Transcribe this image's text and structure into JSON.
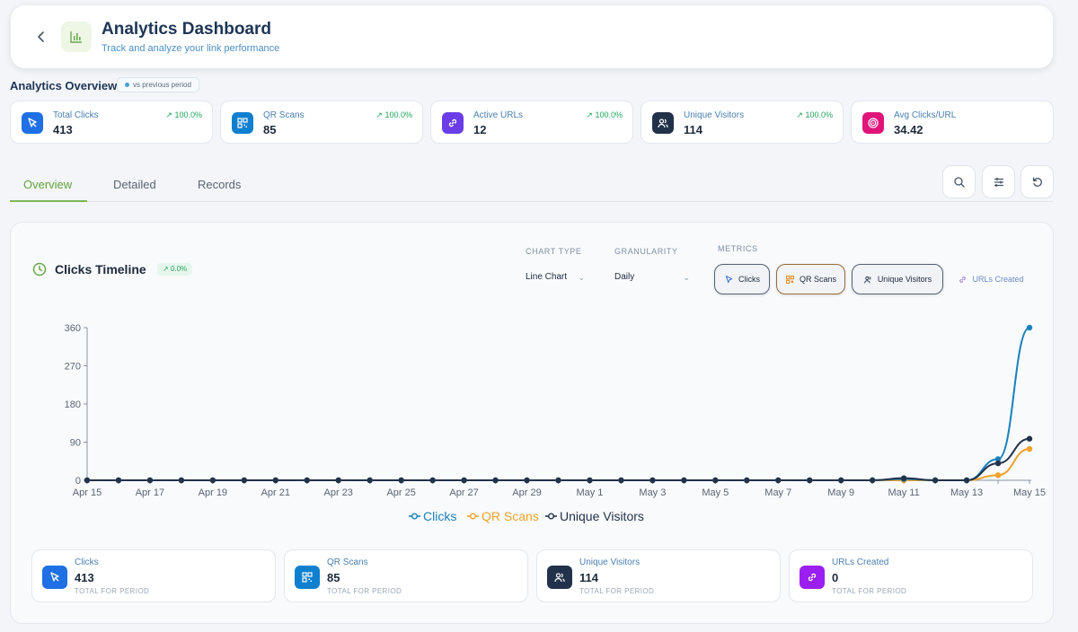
{
  "header": {
    "title": "Analytics Dashboard",
    "subtitle": "Track and analyze your link performance"
  },
  "overview": {
    "title": "Analytics Overview",
    "badge": "vs previous period",
    "cards": [
      {
        "label": "Total Clicks",
        "value": "413",
        "change": "100.0%",
        "icon": "cursor-icon",
        "color": "#1f6fe5"
      },
      {
        "label": "QR Scans",
        "value": "85",
        "change": "100.0%",
        "icon": "qr-icon",
        "color": "#0f7fd0"
      },
      {
        "label": "Active URLs",
        "value": "12",
        "change": "100.0%",
        "icon": "link-icon",
        "color": "#6a3de8"
      },
      {
        "label": "Unique Visitors",
        "value": "114",
        "change": "100.0%",
        "icon": "users-icon",
        "color": "#22324a"
      },
      {
        "label": "Avg Clicks/URL",
        "value": "34.42",
        "change": "",
        "icon": "target-icon",
        "color": "#e0157a"
      }
    ]
  },
  "tabs": [
    {
      "label": "Overview",
      "active": true
    },
    {
      "label": "Detailed",
      "active": false
    },
    {
      "label": "Records",
      "active": false
    }
  ],
  "toolbar_icons": [
    "search-icon",
    "sliders-icon",
    "refresh-icon"
  ],
  "panel": {
    "title": "Clicks Timeline",
    "change": "0.0%",
    "chart_type_label": "CHART TYPE",
    "chart_type_value": "Line Chart",
    "granularity_label": "GRANULARITY",
    "granularity_value": "Daily",
    "metrics_label": "METRICS",
    "metrics": [
      {
        "label": "Clicks",
        "active": true
      },
      {
        "label": "QR Scans",
        "active": true
      },
      {
        "label": "Unique Visitors",
        "active": true
      },
      {
        "label": "URLs Created",
        "active": false
      }
    ]
  },
  "chart_data": {
    "type": "line",
    "x": [
      "Apr 15",
      "Apr 16",
      "Apr 17",
      "Apr 18",
      "Apr 19",
      "Apr 20",
      "Apr 21",
      "Apr 22",
      "Apr 23",
      "Apr 24",
      "Apr 25",
      "Apr 26",
      "Apr 27",
      "Apr 28",
      "Apr 29",
      "Apr 30",
      "May 1",
      "May 2",
      "May 3",
      "May 4",
      "May 5",
      "May 6",
      "May 7",
      "May 8",
      "May 9",
      "May 10",
      "May 11",
      "May 12",
      "May 13",
      "May 14",
      "May 15"
    ],
    "x_tick_labels": [
      "Apr 15",
      "Apr 17",
      "Apr 19",
      "Apr 21",
      "Apr 23",
      "Apr 25",
      "Apr 27",
      "Apr 29",
      "May 1",
      "May 3",
      "May 5",
      "May 7",
      "May 9",
      "May 11",
      "May 13",
      "May 15"
    ],
    "y_ticks": [
      0,
      90,
      180,
      270,
      360
    ],
    "ylim": [
      0,
      360
    ],
    "grid": false,
    "legend": "bottom-center",
    "series": [
      {
        "name": "Clicks",
        "color": "#1a80bb",
        "values": [
          0,
          0,
          0,
          0,
          0,
          0,
          0,
          0,
          0,
          0,
          0,
          0,
          0,
          0,
          0,
          0,
          0,
          0,
          0,
          0,
          0,
          0,
          0,
          0,
          0,
          0,
          3,
          0,
          0,
          50,
          360
        ]
      },
      {
        "name": "QR Scans",
        "color": "#f0a22c",
        "values": [
          0,
          0,
          0,
          0,
          0,
          0,
          0,
          0,
          0,
          0,
          0,
          0,
          0,
          0,
          0,
          0,
          0,
          0,
          0,
          0,
          0,
          0,
          0,
          0,
          0,
          0,
          0,
          0,
          0,
          12,
          74
        ]
      },
      {
        "name": "Unique Visitors",
        "color": "#22324a",
        "values": [
          0,
          0,
          0,
          0,
          0,
          0,
          0,
          0,
          0,
          0,
          0,
          0,
          0,
          0,
          0,
          0,
          0,
          0,
          0,
          0,
          0,
          0,
          0,
          0,
          0,
          0,
          5,
          0,
          0,
          40,
          98
        ]
      }
    ]
  },
  "summary": [
    {
      "label": "Clicks",
      "value": "413",
      "sub": "TOTAL FOR PERIOD",
      "icon": "cursor-icon",
      "color": "#1f6fe5"
    },
    {
      "label": "QR Scans",
      "value": "85",
      "sub": "TOTAL FOR PERIOD",
      "icon": "qr-icon",
      "color": "#0f7fd0"
    },
    {
      "label": "Unique Visitors",
      "value": "114",
      "sub": "TOTAL FOR PERIOD",
      "icon": "users-icon",
      "color": "#22324a"
    },
    {
      "label": "URLs Created",
      "value": "0",
      "sub": "TOTAL FOR PERIOD",
      "icon": "link-icon",
      "color": "#9b1ff0"
    }
  ]
}
